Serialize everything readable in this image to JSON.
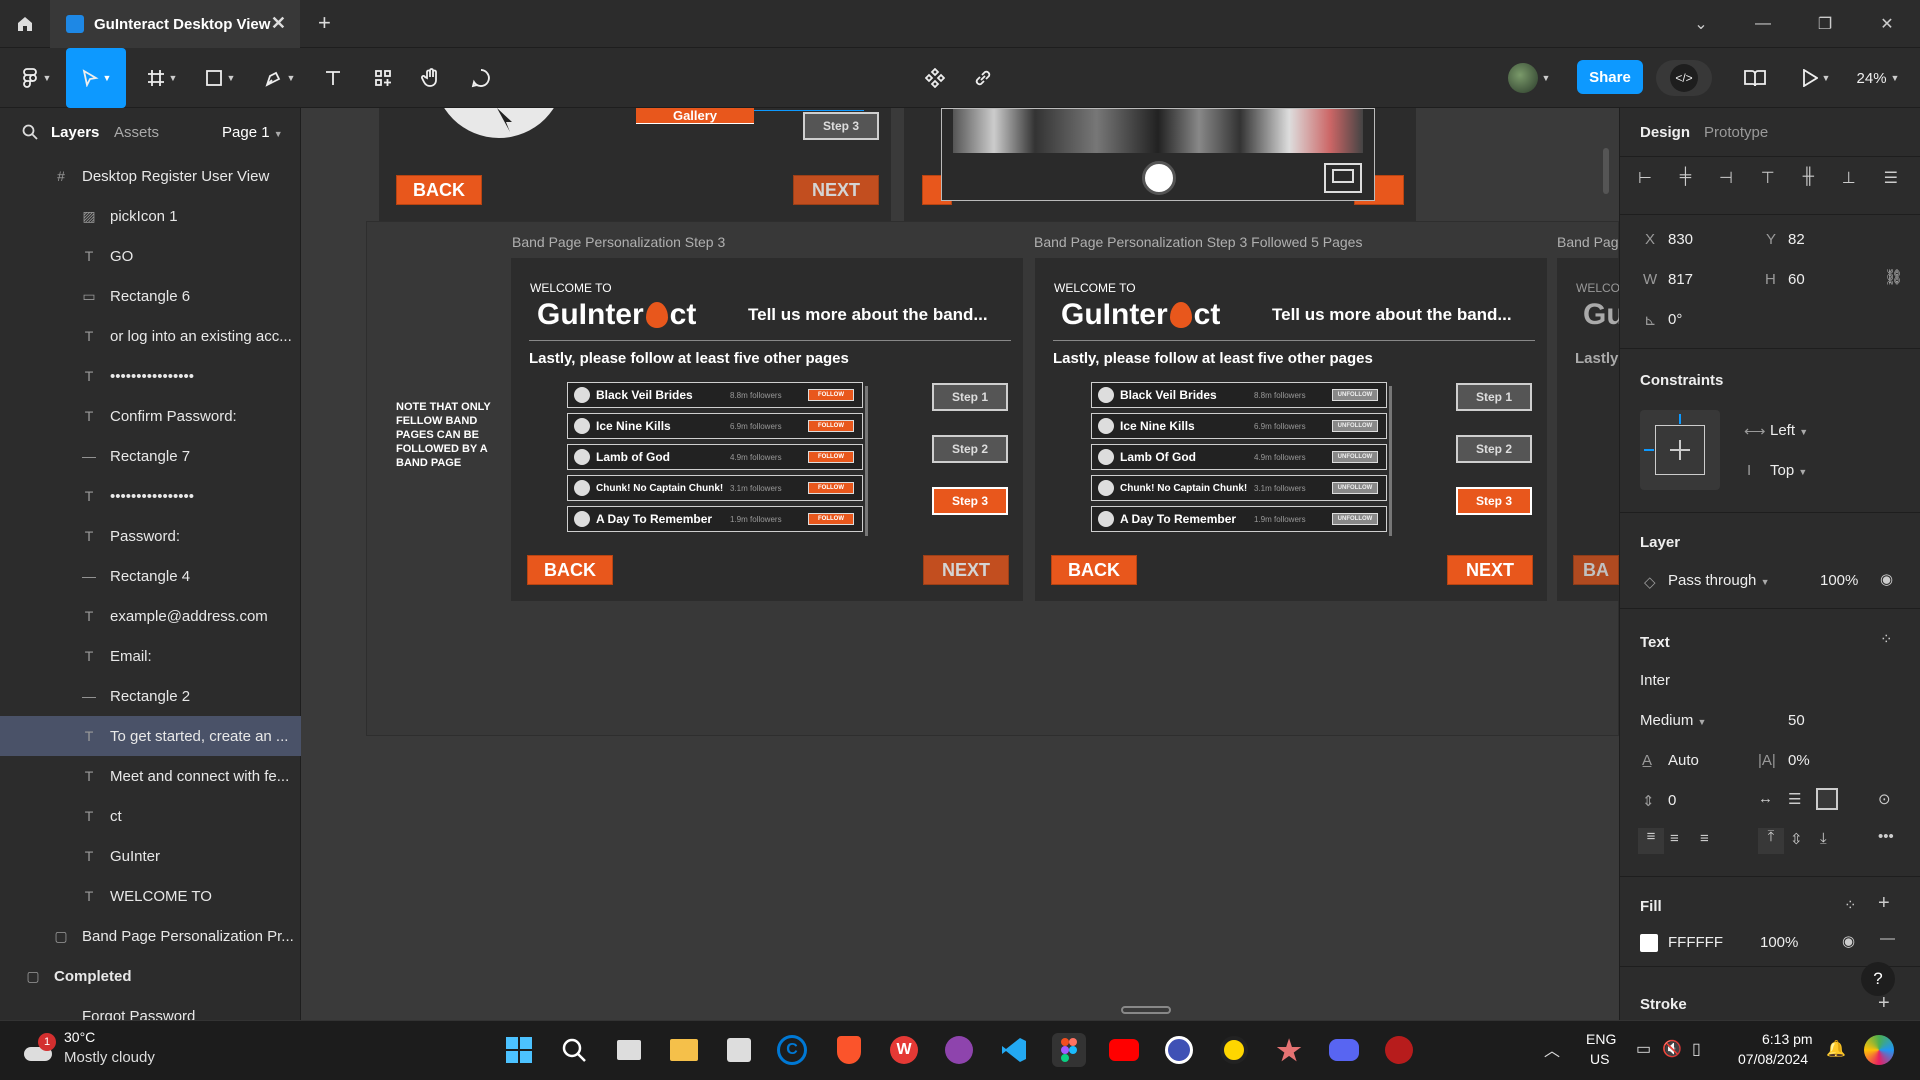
{
  "window": {
    "tab_title": "GuInteract Desktop View",
    "new_tab": "+"
  },
  "toolbar": {
    "share_label": "Share",
    "zoom": "24%"
  },
  "left_panel": {
    "tabs": {
      "layers": "Layers",
      "assets": "Assets",
      "page": "Page 1"
    },
    "layers": [
      {
        "icon": "#",
        "label": "Desktop Register User View"
      },
      {
        "icon": "▨",
        "label": "pickIcon 1"
      },
      {
        "icon": "T",
        "label": "GO"
      },
      {
        "icon": "▭",
        "label": "Rectangle 6"
      },
      {
        "icon": "T",
        "label": "or log into an existing acc..."
      },
      {
        "icon": "T",
        "label": "••••••••••••••••"
      },
      {
        "icon": "T",
        "label": "Confirm Password:"
      },
      {
        "icon": "—",
        "label": "Rectangle 7"
      },
      {
        "icon": "T",
        "label": "••••••••••••••••"
      },
      {
        "icon": "T",
        "label": "Password:"
      },
      {
        "icon": "—",
        "label": "Rectangle 4"
      },
      {
        "icon": "T",
        "label": "example@address.com"
      },
      {
        "icon": "T",
        "label": "Email:"
      },
      {
        "icon": "—",
        "label": "Rectangle 2"
      },
      {
        "icon": "T",
        "label": "To get started, create an ..."
      },
      {
        "icon": "T",
        "label": "Meet and connect with fe..."
      },
      {
        "icon": "T",
        "label": "ct"
      },
      {
        "icon": "T",
        "label": "GuInter"
      },
      {
        "icon": "T",
        "label": "WELCOME TO"
      },
      {
        "icon": "▢",
        "label": "Band Page Personalization Pr..."
      },
      {
        "icon": "▢",
        "label": "Completed"
      },
      {
        "icon": "",
        "label": "Forgot Password"
      }
    ]
  },
  "canvas": {
    "top_frames": {
      "gallery": "Gallery",
      "step3": "Step 3",
      "back": "BACK",
      "next": "NEXT"
    },
    "note": "NOTE THAT ONLY FELLOW BAND PAGES CAN BE FOLLOWED BY A BAND PAGE",
    "frame_a_label": "Band Page Personalization Step 3",
    "frame_b_label": "Band Page Personalization Step 3 Followed 5 Pages",
    "frame_c_label": "Band Pag",
    "welcome": "WELCOME TO",
    "logo_left": "GuInter",
    "logo_right": "ct",
    "tell_us": "Tell us more about the band...",
    "lastly": "Lastly, please follow at least five other pages",
    "step1": "Step 1",
    "step2": "Step 2",
    "step3": "Step 3",
    "back": "BACK",
    "next": "NEXT",
    "frame_c_logo": "Gu",
    "frame_c_welcome": "WELCO",
    "frame_c_lastly": "Lastly",
    "frame_c_back": "BA",
    "bands_a": [
      {
        "name": "Black Veil Brides",
        "followers": "8.8m followers",
        "action": "FOLLOW"
      },
      {
        "name": "Ice Nine Kills",
        "followers": "6.9m followers",
        "action": "FOLLOW"
      },
      {
        "name": "Lamb of God",
        "followers": "4.9m followers",
        "action": "FOLLOW"
      },
      {
        "name": "Chunk! No Captain Chunk!",
        "followers": "3.1m followers",
        "action": "FOLLOW"
      },
      {
        "name": "A Day To Remember",
        "followers": "1.9m followers",
        "action": "FOLLOW"
      }
    ],
    "bands_b": [
      {
        "name": "Black Veil Brides",
        "followers": "8.8m followers",
        "action": "UNFOLLOW"
      },
      {
        "name": "Ice Nine Kills",
        "followers": "6.9m followers",
        "action": "UNFOLLOW"
      },
      {
        "name": "Lamb Of God",
        "followers": "4.9m followers",
        "action": "UNFOLLOW"
      },
      {
        "name": "Chunk! No Captain Chunk!",
        "followers": "3.1m followers",
        "action": "UNFOLLOW"
      },
      {
        "name": "A Day To Remember",
        "followers": "1.9m followers",
        "action": "UNFOLLOW"
      }
    ]
  },
  "right_panel": {
    "tabs": {
      "design": "Design",
      "prototype": "Prototype"
    },
    "x_label": "X",
    "x": "830",
    "y_label": "Y",
    "y": "82",
    "w_label": "W",
    "w": "817",
    "h_label": "H",
    "h": "60",
    "rotation": "0°",
    "constraints_title": "Constraints",
    "constraint_h": "Left",
    "constraint_v": "Top",
    "layer_title": "Layer",
    "blend": "Pass through",
    "opacity": "100%",
    "text_title": "Text",
    "font": "Inter",
    "weight": "Medium",
    "size": "50",
    "line_height": "Auto",
    "letter_spacing": "0%",
    "para_spacing": "0",
    "fill_title": "Fill",
    "fill_hex": "FFFFFF",
    "fill_opacity": "100%",
    "stroke_title": "Stroke",
    "help": "?"
  },
  "taskbar": {
    "weather_temp": "30°C",
    "weather_desc": "Mostly cloudy",
    "weather_badge": "1",
    "lang_top": "ENG",
    "lang_bottom": "US",
    "time": "6:13 pm",
    "date": "07/08/2024"
  },
  "colors": {
    "accent": "#0d99ff",
    "orange": "#e8571c",
    "selection": "#4a5268"
  }
}
